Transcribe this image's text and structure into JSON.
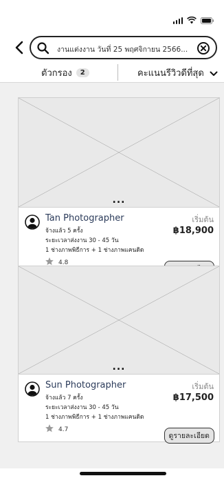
{
  "search": {
    "query_text": "งานแต่งงาน  วันที่ 25 พฤศจิกายน 2566..."
  },
  "filter": {
    "label": "ตัวกรอง",
    "count": "2"
  },
  "sort": {
    "label": "คะแนนรีวิวดีที่สุด"
  },
  "icons": [
    "signal-icon",
    "wifi-icon",
    "battery-icon",
    "back-icon",
    "search-icon",
    "clear-icon",
    "chevron-down-icon",
    "avatar-icon",
    "star-icon",
    "more-dots-icon"
  ],
  "listings": [
    {
      "name": "Tan Photographer",
      "hired": "จ้างแล้ว 5 ครั้ง",
      "delivery": "ระยะเวลาส่งงาน 30 - 45 วัน",
      "crew": "1 ช่างภาพพิธีการ + 1 ช่างภาพแคนดิด",
      "rating": "4.8",
      "price_prefix": "เริ่มต้น",
      "price": "฿18,900",
      "details_label": "ดูรายละเอียด",
      "more": "..."
    },
    {
      "name": "Sun Photographer",
      "hired": "จ้างแล้ว 7 ครั้ง",
      "delivery": "ระยะเวลาส่งงาน 30 - 45 วัน",
      "crew": "1 ช่างภาพพิธีการ + 1 ช่างภาพแคนดิด",
      "rating": "4.7",
      "price_prefix": "เริ่มต้น",
      "price": "฿17,500",
      "details_label": "ดูรายละเอียด",
      "more": "..."
    }
  ]
}
